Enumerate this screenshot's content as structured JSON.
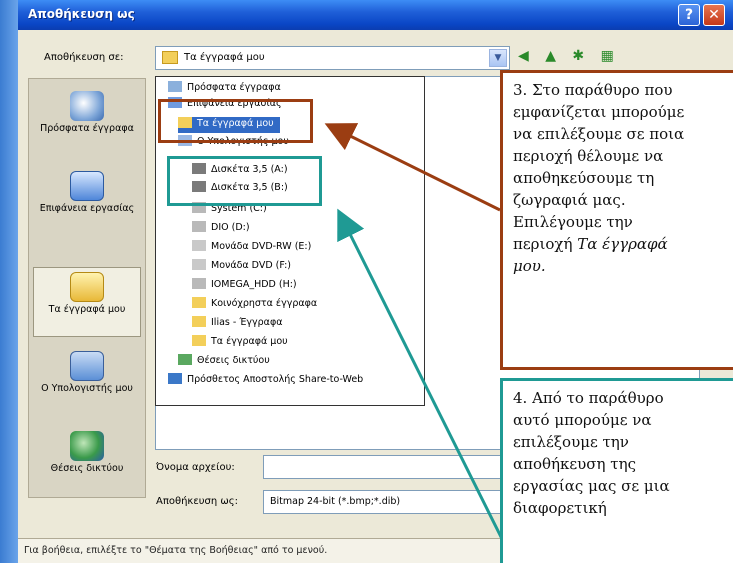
{
  "window": {
    "title": "Αποθήκευση ως",
    "help_button": "?",
    "close_button": "✕"
  },
  "save_in": {
    "label": "Αποθήκευση σε:",
    "value": "Τα έγγραφά μου",
    "toolbar_icons": "◀ ▲ ✱ ▦"
  },
  "places": [
    {
      "label": "Πρόσφατα έγγραφα",
      "icon": "recent-documents-icon",
      "selected": false
    },
    {
      "label": "Επιφάνεια εργασίας",
      "icon": "desktop-icon",
      "selected": false
    },
    {
      "label": "Τα έγγραφά μου",
      "icon": "my-documents-icon",
      "selected": true
    },
    {
      "label": "Ο Υπολογιστής μου",
      "icon": "my-computer-icon",
      "selected": false
    },
    {
      "label": "Θέσεις δικτύου",
      "icon": "network-places-icon",
      "selected": false
    }
  ],
  "dropdown_items": [
    {
      "label": "Πρόσφατα έγγραφα",
      "indent": 0,
      "icon": "recent-icon",
      "selected": false
    },
    {
      "label": "Επιφάνεια εργασίας",
      "indent": 0,
      "icon": "desktop-icon",
      "selected": false
    },
    {
      "label": "Τα έγγραφά μου",
      "indent": 1,
      "icon": "folder-icon",
      "selected": true
    },
    {
      "label": "Ο Υπολογιστής μου",
      "indent": 1,
      "icon": "computer-icon",
      "selected": false
    },
    {
      "label": "Δισκέτα 3,5 (A:)",
      "indent": 2,
      "icon": "floppy-icon",
      "selected": false
    },
    {
      "label": "Δισκέτα 3,5 (B:)",
      "indent": 2,
      "icon": "floppy-icon",
      "selected": false
    },
    {
      "label": "System (C:)",
      "indent": 2,
      "icon": "drive-icon",
      "selected": false
    },
    {
      "label": "DIO (D:)",
      "indent": 2,
      "icon": "drive-icon",
      "selected": false
    },
    {
      "label": "Μονάδα DVD-RW (E:)",
      "indent": 2,
      "icon": "dvd-icon",
      "selected": false
    },
    {
      "label": "Μονάδα DVD (F:)",
      "indent": 2,
      "icon": "dvd-icon",
      "selected": false
    },
    {
      "label": "IOMEGA_HDD (H:)",
      "indent": 2,
      "icon": "drive-icon",
      "selected": false
    },
    {
      "label": "Κοινόχρηστα έγγραφα",
      "indent": 2,
      "icon": "folder-icon",
      "selected": false
    },
    {
      "label": "Ilias - Έγγραφα",
      "indent": 2,
      "icon": "folder-icon",
      "selected": false
    },
    {
      "label": "Τα έγγραφά μου",
      "indent": 2,
      "icon": "folder-icon",
      "selected": false
    },
    {
      "label": "Θέσεις δικτύου",
      "indent": 1,
      "icon": "network-icon",
      "selected": false
    },
    {
      "label": "Πρόσθετος Αποστολής Share-to-Web",
      "indent": 0,
      "icon": "web-icon",
      "selected": false
    }
  ],
  "filename": {
    "label": "Όνομα αρχείου:",
    "value": ""
  },
  "save_type": {
    "label": "Αποθήκευση ως:",
    "value": "Bitmap 24-bit (*.bmp;*.dib)"
  },
  "status_text": "Για βοήθεια, επιλέξτε το \"Θέματα της Βοήθειας\" από το μενού.",
  "callouts": {
    "c3_lines": [
      "3. Στο παράθυρο που",
      "εμφανίζεται μπορούμε",
      "να επιλέξουμε σε ποια",
      "περιοχή θέλουμε να",
      "αποθηκεύσουμε τη",
      "ζωγραφιά μας.",
      "Επιλέγουμε την"
    ],
    "c3_prefix": "περιοχή ",
    "c3_emph1": "Τα έγγραφά",
    "c3_emph2": "μου.",
    "c4_lines": [
      "4. Από το παράθυρο",
      "αυτό μπορούμε να",
      "επιλέξουμε την",
      "αποθήκευση της",
      "εργασίας μας σε μια",
      "διαφορετική"
    ]
  },
  "colors": {
    "brown": "#9b3d12",
    "teal": "#1f9a94",
    "selection": "#316ac5"
  }
}
